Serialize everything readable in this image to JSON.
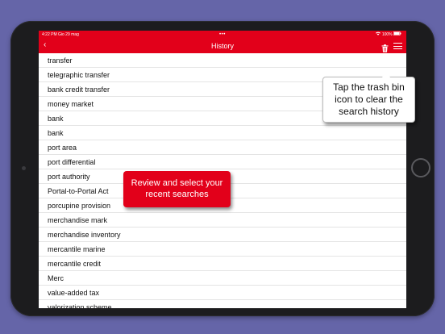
{
  "status_bar": {
    "time": "4:22 PM",
    "date": "Gio 29 mag",
    "dots": "•••",
    "battery": "100%"
  },
  "nav": {
    "back_glyph": "‹",
    "title": "History",
    "trash_icon": "trash-icon",
    "menu_icon": "hamburger-menu-icon"
  },
  "history": {
    "items": [
      "transfer",
      "telegraphic transfer",
      "bank credit transfer",
      "money market",
      "bank",
      "bank",
      "port area",
      "port differential",
      "port authority",
      "Portal-to-Portal Act",
      "porcupine provision",
      "merchandise mark",
      "merchandise inventory",
      "mercantile marine",
      "mercantile credit",
      "Merc",
      "value-added tax",
      "valorization scheme"
    ]
  },
  "callouts": {
    "select": "Review and select your recent searches",
    "trash": "Tap the trash bin icon to clear the search history"
  },
  "colors": {
    "background": "#6565a8",
    "brand_red": "#e2001a",
    "device": "#1c1c1e"
  }
}
